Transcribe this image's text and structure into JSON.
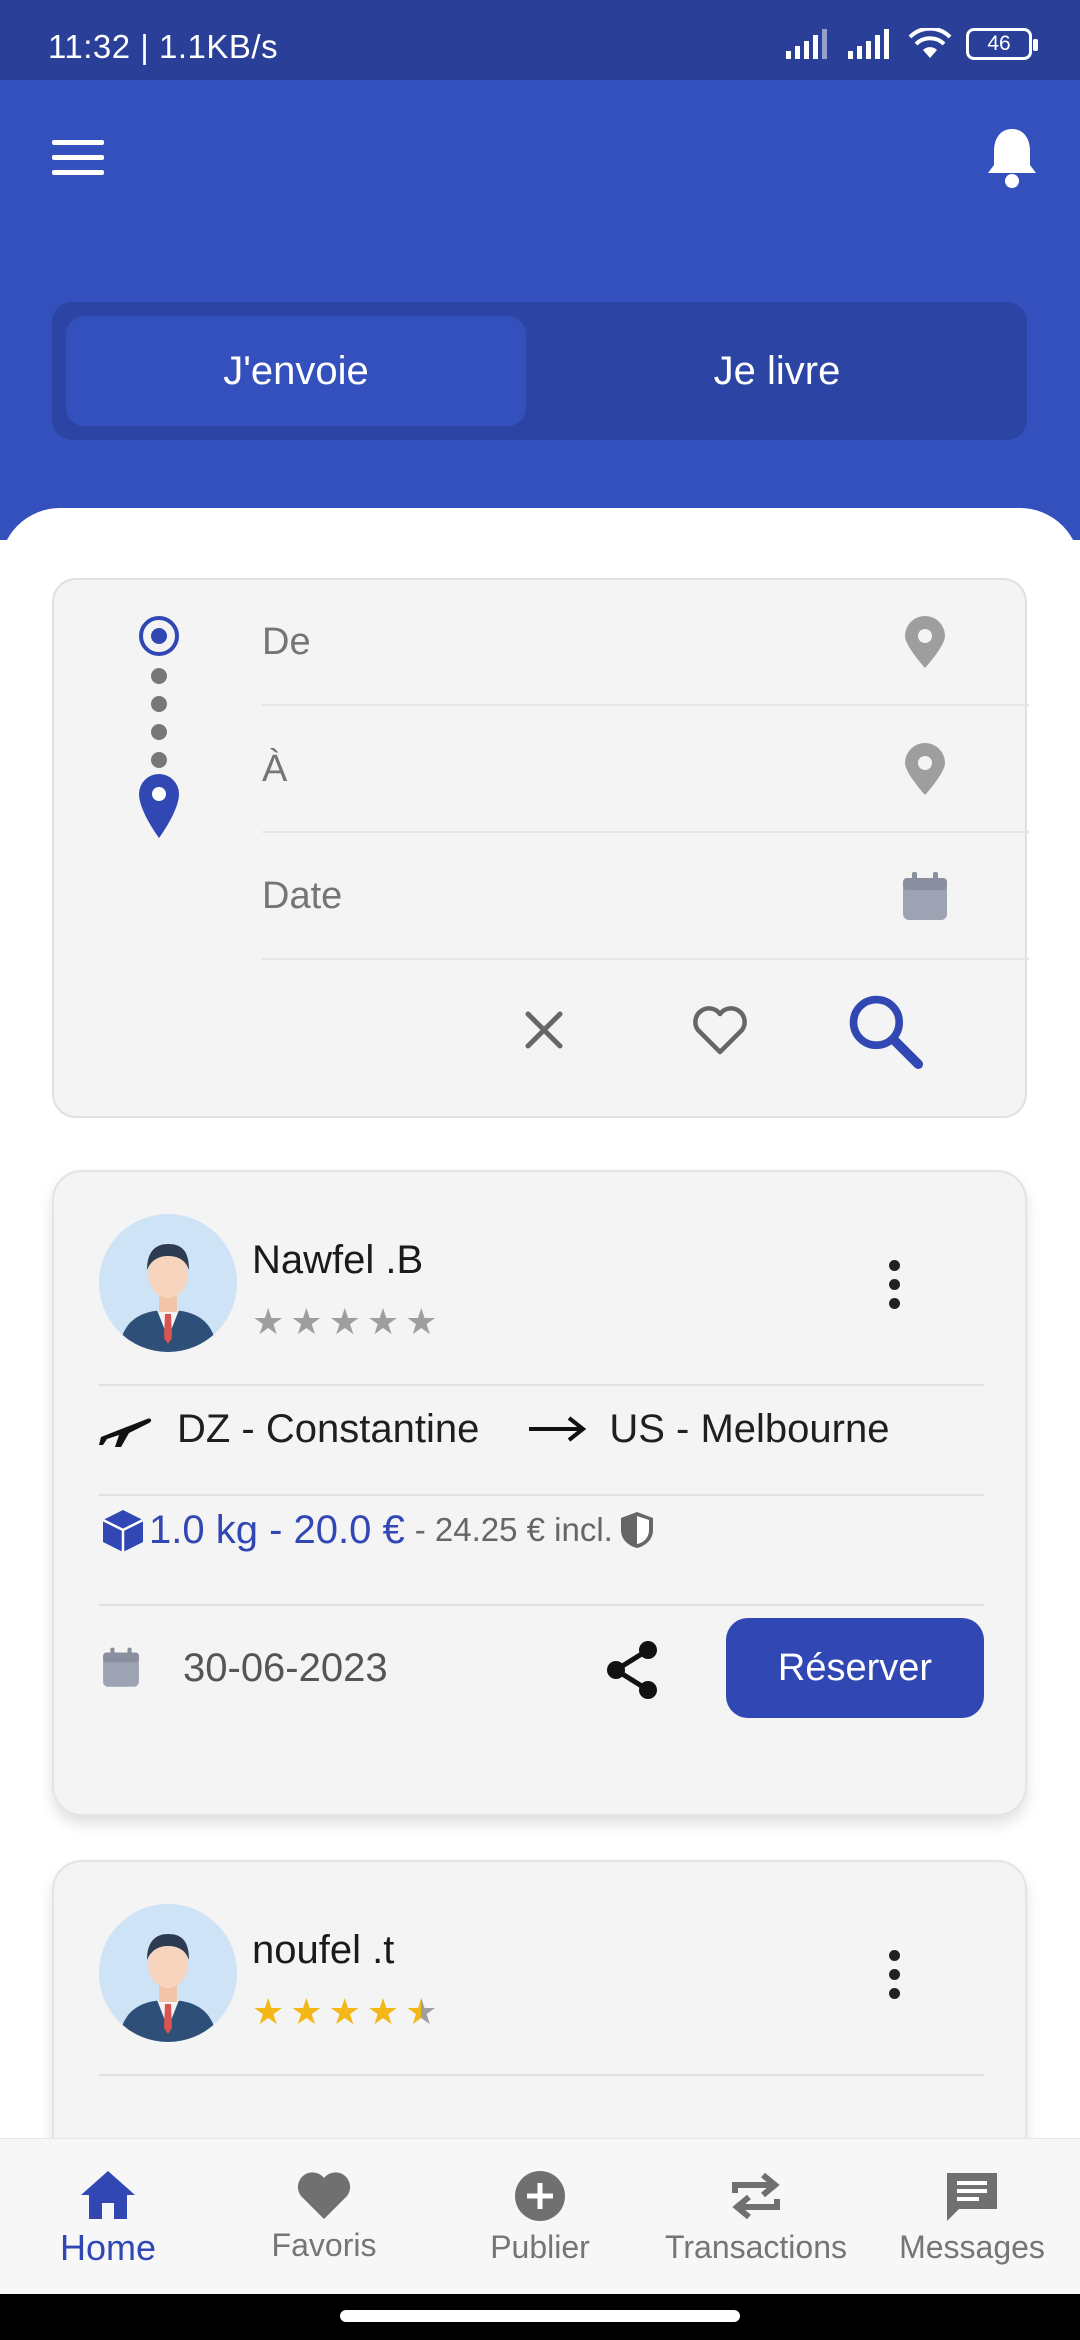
{
  "status_bar": {
    "time": "11:32 | 1.1KB/s",
    "battery": "46"
  },
  "header": {
    "tabs": [
      {
        "label": "J'envoie",
        "active": true
      },
      {
        "label": "Je livre",
        "active": false
      }
    ]
  },
  "search": {
    "from_placeholder": "De",
    "to_placeholder": "À",
    "date_placeholder": "Date"
  },
  "trips": [
    {
      "user": "Nawfel .B",
      "rating": 0,
      "from": "DZ - Constantine",
      "to": "US - Melbourne",
      "price": "1.0 kg - 20.0 €",
      "price_incl": "- 24.25 € incl.",
      "date": "30-06-2023",
      "reserve_label": "Réserver"
    },
    {
      "user": "noufel .t",
      "rating": 4.5
    }
  ],
  "bottom_nav": [
    {
      "label": "Home",
      "icon": "home-icon",
      "active": true
    },
    {
      "label": "Favoris",
      "icon": "heart-icon",
      "active": false
    },
    {
      "label": "Publier",
      "icon": "plus-circle-icon",
      "active": false
    },
    {
      "label": "Transactions",
      "icon": "swap-icon",
      "active": false
    },
    {
      "label": "Messages",
      "icon": "message-icon",
      "active": false
    }
  ],
  "colors": {
    "primary": "#3450bd",
    "accent": "#3147b3",
    "star": "#f3b718"
  }
}
